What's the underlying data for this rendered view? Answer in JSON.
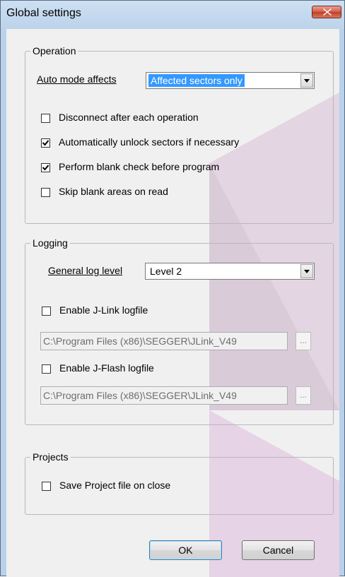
{
  "window": {
    "title": "Global settings"
  },
  "operation": {
    "legend": "Operation",
    "auto_mode_label": "Auto mode affects",
    "auto_mode_value": "Affected sectors only",
    "checkboxes": [
      {
        "label": "Disconnect after each operation",
        "checked": false
      },
      {
        "label": "Automatically unlock sectors if necessary",
        "checked": true
      },
      {
        "label": "Perform blank check before program",
        "checked": true
      },
      {
        "label": "Skip blank areas on read",
        "checked": false
      }
    ]
  },
  "logging": {
    "legend": "Logging",
    "log_level_label": "General log level",
    "log_level_value": "Level 2",
    "jlink_label": "Enable J-Link logfile",
    "jlink_checked": false,
    "jlink_path": "C:\\Program Files (x86)\\SEGGER\\JLink_V49",
    "jflash_label": "Enable J-Flash logfile",
    "jflash_checked": false,
    "jflash_path": "C:\\Program Files (x86)\\SEGGER\\JLink_V49",
    "browse_label": "..."
  },
  "projects": {
    "legend": "Projects",
    "save_label": "Save Project file on close",
    "save_checked": false
  },
  "buttons": {
    "ok": "OK",
    "cancel": "Cancel"
  }
}
